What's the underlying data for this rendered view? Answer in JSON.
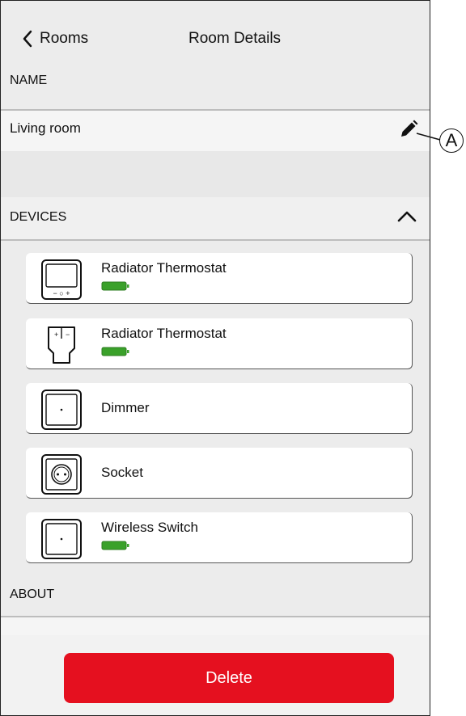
{
  "header": {
    "back_label": "Rooms",
    "title": "Room Details"
  },
  "name_section": {
    "heading": "NAME",
    "value": "Living room"
  },
  "devices_section": {
    "heading": "DEVICES",
    "items": [
      {
        "name": "Radiator Thermostat",
        "icon": "thermostat-display-icon",
        "battery": true,
        "thermostat_buttons": "−  ○  +"
      },
      {
        "name": "Radiator Thermostat",
        "icon": "radiator-valve-icon",
        "battery": true
      },
      {
        "name": "Dimmer",
        "icon": "dimmer-icon",
        "battery": false
      },
      {
        "name": "Socket",
        "icon": "socket-icon",
        "battery": false
      },
      {
        "name": "Wireless Switch",
        "icon": "wireless-switch-icon",
        "battery": true
      }
    ]
  },
  "about_section": {
    "heading": "ABOUT"
  },
  "delete_button": {
    "label": "Delete"
  },
  "callout": {
    "label": "A"
  },
  "colors": {
    "delete": "#e5101f",
    "battery": "#3aa12a",
    "background": "#ececec"
  }
}
